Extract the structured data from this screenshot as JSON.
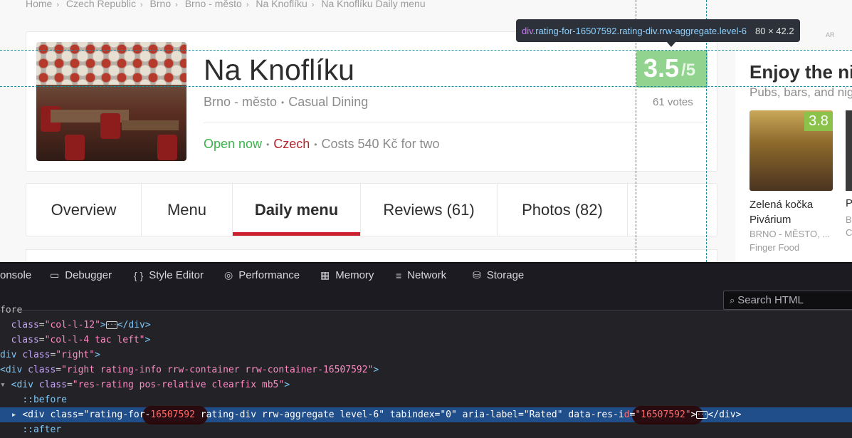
{
  "breadcrumb": [
    "Home",
    "Czech Republic",
    "Brno",
    "Brno - město",
    "Na Knoflíku",
    "Na Knoflíku Daily menu"
  ],
  "restaurant": {
    "name": "Na Knoflíku",
    "locality": "Brno - město",
    "type": "Casual Dining",
    "status": "Open now",
    "cuisine": "Czech",
    "cost": "Costs 540 Kč for two",
    "rating": "3.5",
    "rating_max": "/5",
    "votes": "61 votes"
  },
  "tabs": [
    {
      "label": "Overview"
    },
    {
      "label": "Menu"
    },
    {
      "label": "Daily menu",
      "active": true
    },
    {
      "label": "Reviews (61)"
    },
    {
      "label": "Photos (82)"
    }
  ],
  "side": {
    "title": "Enjoy the ni",
    "subtitle": "Pubs, bars, and nig",
    "card": {
      "rating": "3.8",
      "name": "Zelená kočka Pivárium",
      "location": "BRNO - MĚSTO, ...",
      "category": "Finger Food"
    },
    "next_card_initials": [
      "P",
      "B",
      "C"
    ]
  },
  "inspector": {
    "tooltip_tag": "div",
    "tooltip_classes": ".rating-for-16507592.rating-div.rrw-aggregate.level-6",
    "tooltip_dims": "80 × 42.2",
    "faint_label": "AR"
  },
  "devtools": {
    "tabs": [
      {
        "icon": "",
        "label": "onsole"
      },
      {
        "icon": "▭",
        "label": "Debugger"
      },
      {
        "icon": "{ }",
        "label": "Style Editor"
      },
      {
        "icon": "◎",
        "label": "Performance"
      },
      {
        "icon": "▦",
        "label": "Memory"
      },
      {
        "icon": "≡",
        "label": "Network"
      },
      {
        "icon": "⛁",
        "label": "Storage"
      }
    ],
    "search_placeholder": "Search HTML",
    "code_lines": {
      "l0": "fore",
      "l1_attr": "class",
      "l1_val": "\"col-l-12\"",
      "l2_val": "\"col-l-4 tac left\"",
      "l3_val": "\"right\"",
      "l4_val": "\"right rating-info rrw-container rrw-container-16507592\"",
      "l5_val": "\"res-rating pos-relative clearfix mb5\"",
      "l6": "::before",
      "l7_class_a": "\"rating-for-",
      "l7_class_b": "16507592",
      "l7_class_c": " rating-div rrw-aggregate level-6\"",
      "l7_tab": "\"0\"",
      "l7_aria": "\"Rated\"",
      "l7_resid_attr_a": "data-res-i",
      "l7_resid_attr_b": "d",
      "l7_resid_val": "\"16507592\"",
      "l8": "::after"
    }
  }
}
